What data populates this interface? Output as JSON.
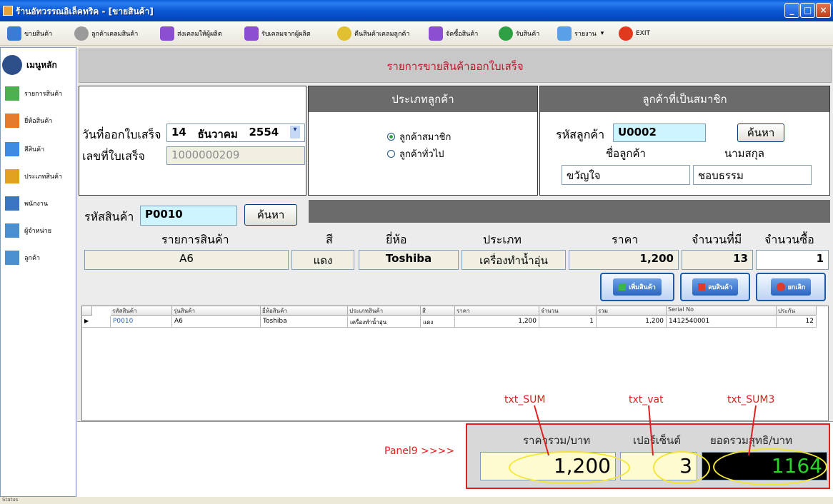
{
  "window": {
    "title": "ร้านอัทวรรณอิเล็คทริค - [ขายสินค้า]"
  },
  "toolbar": {
    "items": [
      {
        "label": "ขายสินค้า"
      },
      {
        "label": "ลูกค้าเคลมสินค้า"
      },
      {
        "label": "ส่งเคลมให้ผู้ผลิต"
      },
      {
        "label": "รับเคลมจากผู้ผลิต"
      },
      {
        "label": "คืนสินค้าเคลมลูกค้า"
      },
      {
        "label": "จัดซื้อสินค้า"
      },
      {
        "label": "รับสินค้า"
      },
      {
        "label": "รายงาน"
      },
      {
        "label": "EXIT"
      }
    ]
  },
  "sidebar": {
    "heading": "เมนูหลัก",
    "items": [
      {
        "label": "รายการสินค้า"
      },
      {
        "label": "ยี่ห้อสินค้า"
      },
      {
        "label": "สีสินค้า"
      },
      {
        "label": "ประเภทสินค้า"
      },
      {
        "label": "พนักงาน"
      },
      {
        "label": "ผู้จำหน่าย"
      },
      {
        "label": "ลูกค้า"
      }
    ]
  },
  "main": {
    "title": "รายการขายสินค้าออกใบเสร็จ",
    "invoice": {
      "date_label": "วันที่ออกใบเสร็จ",
      "date_day": "14",
      "date_month": "ธันวาคม",
      "date_year": "2554",
      "number_label": "เลขที่ใบเสร็จ",
      "number": "1000000209"
    },
    "customer_type": {
      "header": "ประเภทลูกค้า",
      "options": [
        "ลูกค้าสมาชิก",
        "ลูกค้าทั่วไป"
      ],
      "selected": "ลูกค้าสมาชิก"
    },
    "member": {
      "header": "ลูกค้าที่เป็นสมาชิก",
      "code_label": "รหัสลูกค้า",
      "code": "U0002",
      "search_label": "ค้นหา",
      "firstname_label": "ชื่อลูกค้า",
      "lastname_label": "นามสกุล",
      "firstname": "ขวัญใจ",
      "lastname": "ชอบธรรม"
    },
    "product": {
      "code_label": "รหัสสินค้า",
      "code": "P0010",
      "search_label": "ค้นหา",
      "col_item": "รายการสินค้า",
      "col_color": "สี",
      "col_brand": "ยี่ห้อ",
      "col_type": "ประเภท",
      "col_price": "ราคา",
      "col_stock": "จำนวนที่มี",
      "col_qty": "จำนวนซื้อ",
      "item": "A6",
      "color": "แดง",
      "brand": "Toshiba",
      "type": "เครื่องทำน้ำอุ่น",
      "price": "1,200",
      "stock": "13",
      "qty": "1"
    },
    "actions": {
      "add": "เพิ่มสินค้า",
      "remove": "ลบสินค้า",
      "cancel": "ยกเลิก"
    },
    "grid": {
      "columns": [
        "รหัสสินค้า",
        "รุ่นสินค้า",
        "ยี่ห้อสินค้า",
        "ประเภทสินค้า",
        "สี",
        "ราคา",
        "จำนวน",
        "รวม",
        "Serial No",
        "ประกัน"
      ],
      "rows": [
        [
          "P0010",
          "A6",
          "Toshiba",
          "เครื่องทำน้ำอุ่น",
          "แดง",
          "1,200",
          "1",
          "1,200",
          "1412540001",
          "12"
        ]
      ]
    },
    "totals": {
      "sum_label": "ราคารวม/บาท",
      "vat_label": "เปอร์เซ็นต์",
      "net_label": "ยอดรวมสุทธิ/บาท",
      "sum": "1,200",
      "vat": "3",
      "net": "1164"
    },
    "annotations": {
      "sum": "txt_SUM",
      "vat": "txt_vat",
      "net": "txt_SUM3",
      "panel": "Panel9 >>>>"
    }
  },
  "statusbar": {
    "text": "Status"
  },
  "colors": {
    "title_blue": "#0b58d3",
    "header_gray": "#6b6b6b",
    "annotation_red": "#e02020",
    "total_green": "#2ed12e",
    "highlight_yellow": "#fffbd0"
  }
}
